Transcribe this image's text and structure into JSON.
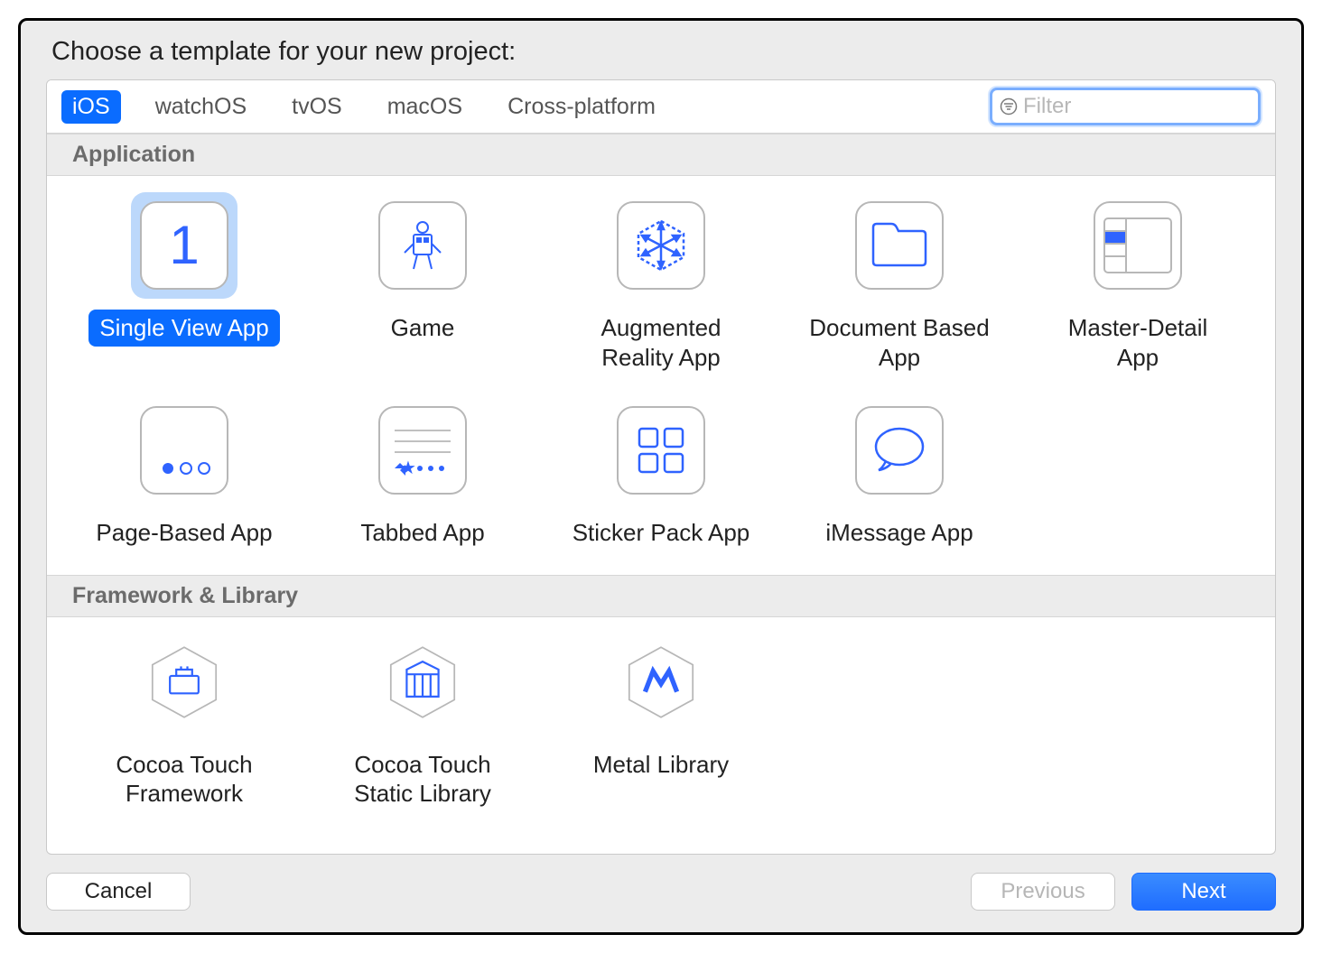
{
  "heading": "Choose a template for your new project:",
  "tabs": [
    "iOS",
    "watchOS",
    "tvOS",
    "macOS",
    "Cross-platform"
  ],
  "selected_tab_index": 0,
  "filter": {
    "placeholder": "Filter",
    "value": ""
  },
  "sections": [
    {
      "title": "Application",
      "items": [
        {
          "label": "Single View App",
          "icon": "single-view",
          "selected": true
        },
        {
          "label": "Game",
          "icon": "game"
        },
        {
          "label": "Augmented Reality App",
          "icon": "ar"
        },
        {
          "label": "Document Based App",
          "icon": "document"
        },
        {
          "label": "Master-Detail App",
          "icon": "master-detail"
        },
        {
          "label": "Page-Based App",
          "icon": "page-based"
        },
        {
          "label": "Tabbed App",
          "icon": "tabbed"
        },
        {
          "label": "Sticker Pack App",
          "icon": "sticker"
        },
        {
          "label": "iMessage App",
          "icon": "imessage"
        }
      ]
    },
    {
      "title": "Framework & Library",
      "items": [
        {
          "label": "Cocoa Touch Framework",
          "icon": "framework",
          "shape": "hex"
        },
        {
          "label": "Cocoa Touch Static Library",
          "icon": "static-library",
          "shape": "hex"
        },
        {
          "label": "Metal Library",
          "icon": "metal",
          "shape": "hex"
        }
      ]
    }
  ],
  "buttons": {
    "cancel": "Cancel",
    "previous": "Previous",
    "next": "Next"
  },
  "colors": {
    "accent": "#0a6cff",
    "selection_bg": "#bcd8fb",
    "icon_stroke": "#2f63ff"
  }
}
